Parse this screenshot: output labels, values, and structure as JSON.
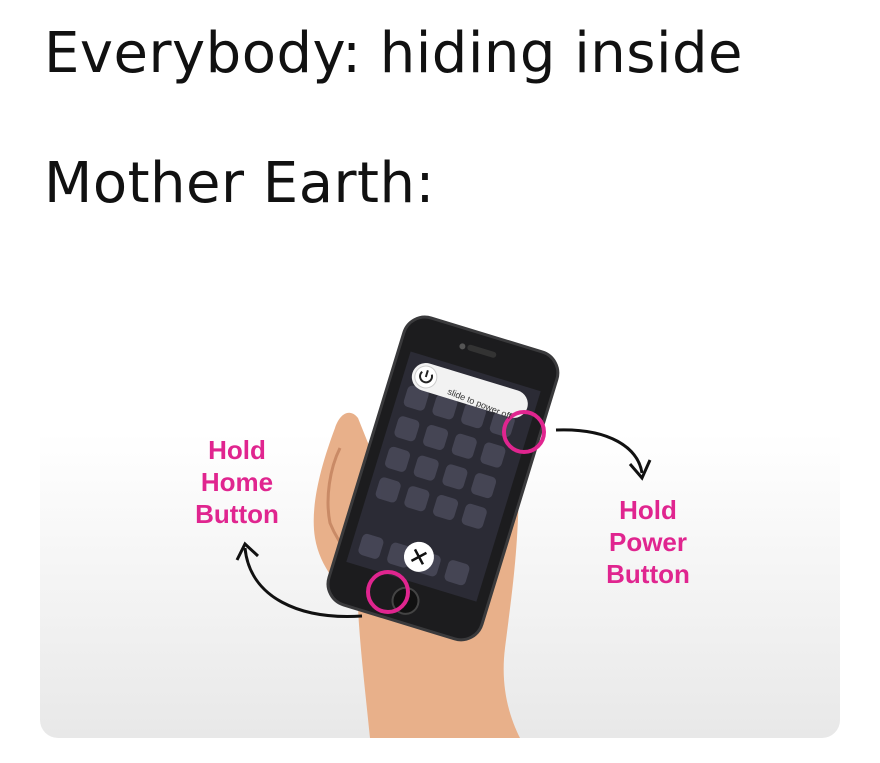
{
  "captions": {
    "line1": "Everybody: hiding inside",
    "line2": "Mother Earth:"
  },
  "illustration": {
    "home_label": "Hold Home Button",
    "home_label_lines": [
      "Hold",
      "Home",
      "Button"
    ],
    "power_label_lines": [
      "Hold",
      "Power",
      "Button"
    ],
    "power_off_slider": "slide to power off",
    "accent_color": "#e0258f",
    "icons": [
      "power-icon",
      "close-icon",
      "arrow-icon"
    ]
  }
}
